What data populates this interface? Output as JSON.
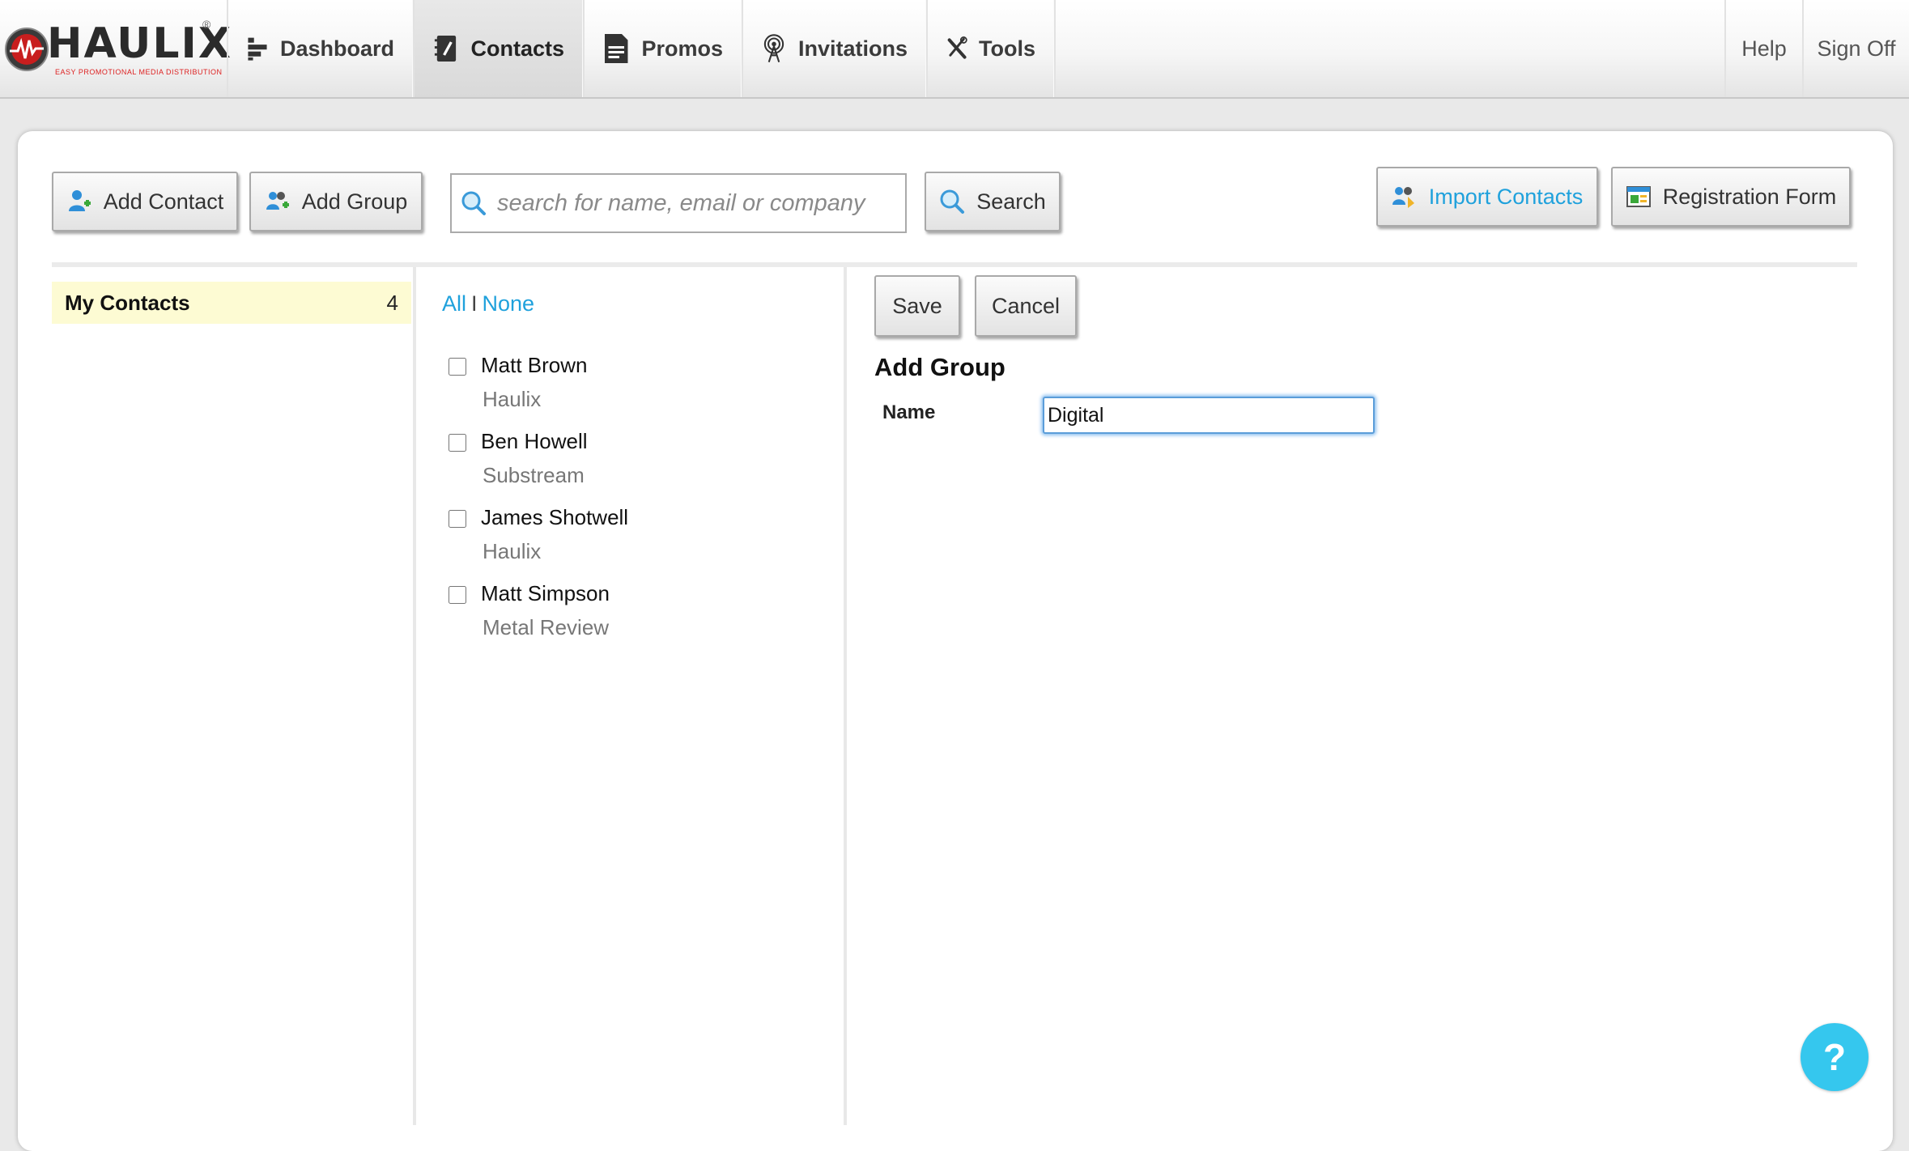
{
  "brand": {
    "name": "HAULIX",
    "tagline": "EASY PROMOTIONAL MEDIA DISTRIBUTION",
    "reg": "®"
  },
  "nav": {
    "items": [
      {
        "label": "Dashboard",
        "icon": "dashboard-icon"
      },
      {
        "label": "Contacts",
        "icon": "contacts-icon",
        "active": true
      },
      {
        "label": "Promos",
        "icon": "promos-icon"
      },
      {
        "label": "Invitations",
        "icon": "invitations-icon"
      },
      {
        "label": "Tools",
        "icon": "tools-icon"
      }
    ],
    "help": "Help",
    "sign_off": "Sign Off"
  },
  "toolbar": {
    "add_contact": "Add Contact",
    "add_group": "Add Group",
    "search_placeholder": "search for name, email or company",
    "search_value": "",
    "search_button": "Search",
    "import_contacts": "Import Contacts",
    "registration_form": "Registration Form"
  },
  "groups": [
    {
      "name": "My Contacts",
      "count": "4"
    }
  ],
  "selection": {
    "all": "All",
    "separator": "I",
    "none": "None"
  },
  "contacts": [
    {
      "name": "Matt Brown",
      "company": "Haulix",
      "checked": false
    },
    {
      "name": "Ben Howell",
      "company": "Substream",
      "checked": false
    },
    {
      "name": "James Shotwell",
      "company": "Haulix",
      "checked": false
    },
    {
      "name": "Matt Simpson",
      "company": "Metal Review",
      "checked": false
    }
  ],
  "form": {
    "save": "Save",
    "cancel": "Cancel",
    "title": "Add Group",
    "name_label": "Name",
    "name_value": "Digital"
  },
  "help_fab": "?",
  "colors": {
    "link": "#1fa1dc",
    "highlight_row": "#fdfbd3",
    "focus": "#5b9dd9",
    "fab": "#35c7ee"
  }
}
